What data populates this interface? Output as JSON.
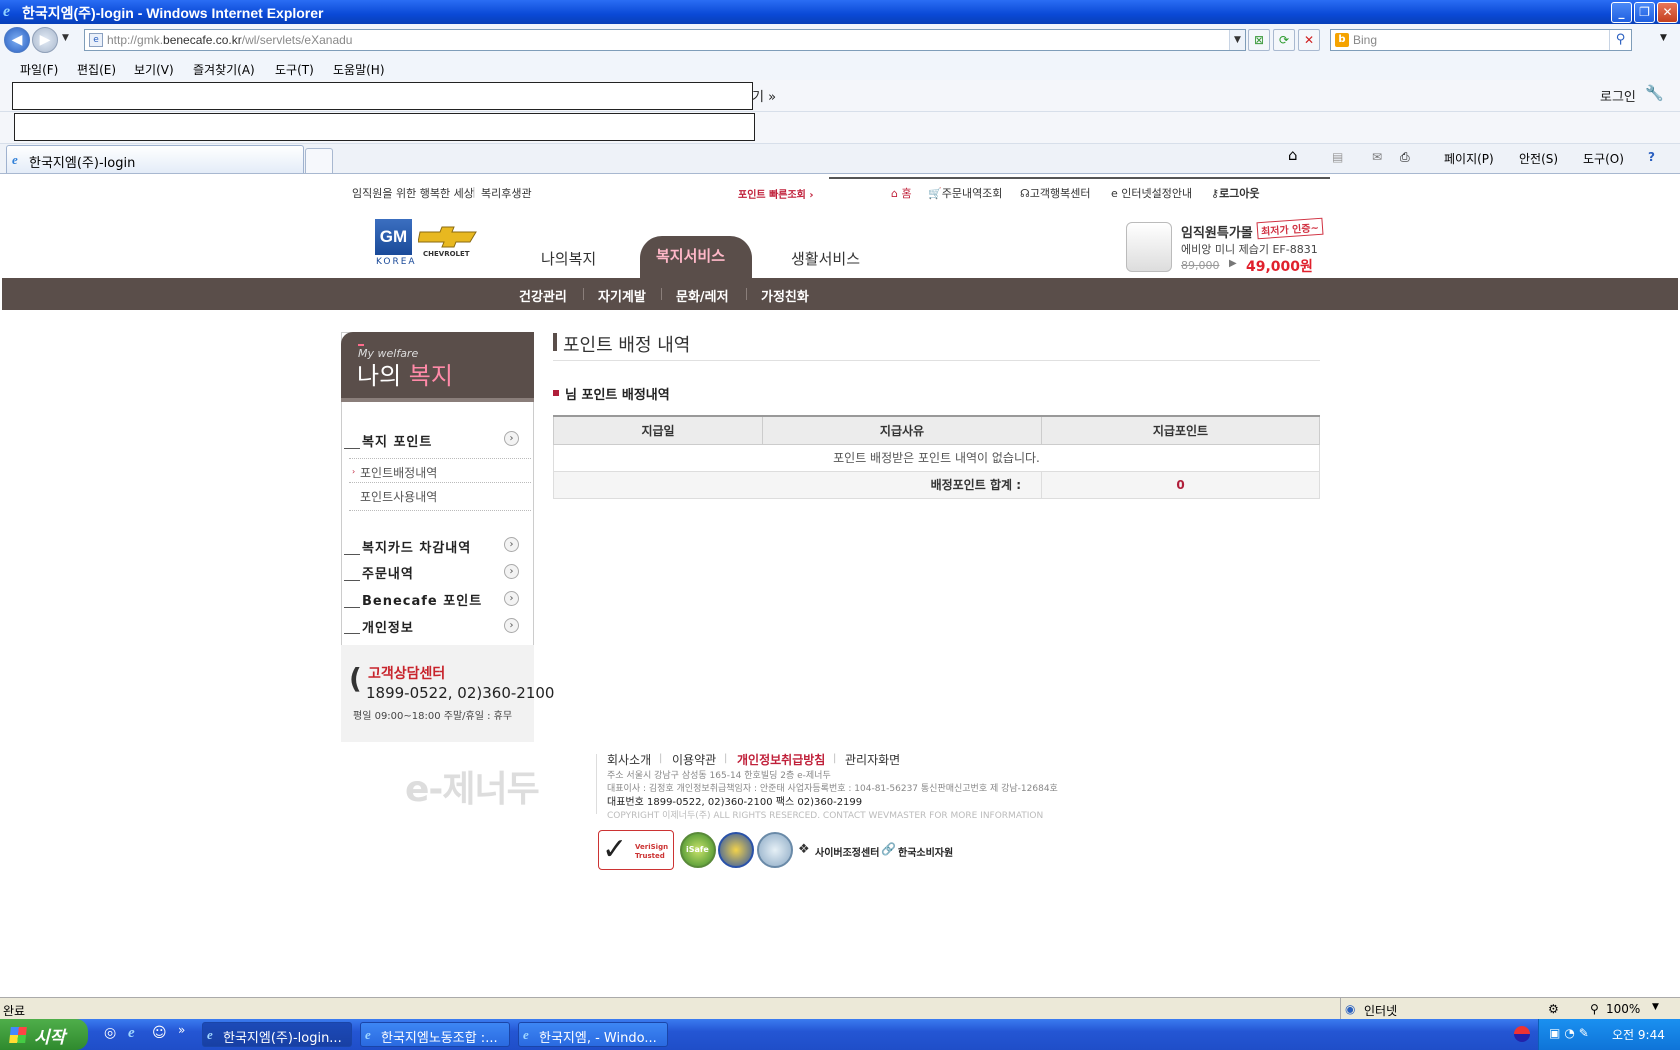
{
  "window": {
    "title": "한국지엠(주)-login - Windows Internet Explorer"
  },
  "address": {
    "url_prefix": "http://gmk.",
    "url_domain": "benecafe.co.kr",
    "url_path": "/wl/servlets/eXanadu"
  },
  "search": {
    "placeholder": "Bing"
  },
  "menu": [
    "파일(F)",
    "편집(E)",
    "보기(V)",
    "즐겨찾기(A)",
    "도구(T)",
    "도움말(H)"
  ],
  "toolbar": {
    "more": "기 »",
    "login": "로그인"
  },
  "tab": {
    "label": "한국지엠(주)-login"
  },
  "commands": {
    "page": "페이지(P)",
    "safety": "안전(S)",
    "tools": "도구(O)"
  },
  "site": {
    "top_left": [
      "임직원을 위한 행복한 세상",
      "복리후생관"
    ],
    "quick_point": "포인트 빠른조회 ›",
    "top_right": [
      "홈",
      "주문내역조회",
      "고객행복센터",
      "인터넷설정안내",
      "로그아웃"
    ],
    "logo": {
      "gm": "GM",
      "korea": "KOREA",
      "chevrolet": "CHEVROLET"
    },
    "main_tabs": [
      "나의복지",
      "복지서비스",
      "생활서비스"
    ],
    "sub_nav": [
      "건강관리",
      "자기계발",
      "문화/레저",
      "가정친화"
    ],
    "ad": {
      "title": "임직원특가몰",
      "badge": "최저가 인증~",
      "model": "에비앙 미니 제습기 EF-8831",
      "old_price": "89,000",
      "new_price": "49,000원"
    }
  },
  "sidebar": {
    "eyebrow": "My welfare",
    "title_a": "나의 ",
    "title_b": "복지",
    "point_menu": "복지 포인트",
    "sub_items": [
      "포인트배정내역",
      "포인트사용내역"
    ],
    "items": [
      "복지카드 차감내역",
      "주문내역",
      "Benecafe 포인트",
      "개인정보"
    ],
    "cs": {
      "title": "고객상담센터",
      "numbers": "1899-0522, 02)360-2100",
      "hours": "평일 09:00~18:00  주말/휴일 : 휴무"
    }
  },
  "content": {
    "title": "포인트 배정 내역",
    "subtitle": "님 포인트 배정내역",
    "columns": [
      "지급일",
      "지급사유",
      "지급포인트"
    ],
    "empty_message": "포인트 배정받은 포인트 내역이 없습니다.",
    "total_label": "배정포인트 합계 :",
    "total_value": "0"
  },
  "footer": {
    "logo": "e-제너두",
    "links": [
      "회사소개",
      "이용약관",
      "개인정보취급방침",
      "관리자화면"
    ],
    "address": "주소 서울시 강남구 삼성동 165-14 한호빌딩 2층 e-제너두",
    "ceo": "대표이사 : 김정호    개인정보취급책임자 : 안준태      사업자등록번호 : 104-81-56237   통신판매신고번호  제 강남-12684호",
    "phone": "대표번호 1899-0522, 02)360-2100   팩스 02)360-2199",
    "copyright": "COPYRIGHT 이제너두(주) ALL RIGHTS RESERCED.  CONTACT WEVMASTER FOR MORE INFORMATION",
    "certs": [
      "VeriSign Trusted",
      "iSafe",
      "사이버조정센터",
      "한국소비자원"
    ]
  },
  "status": {
    "left": "완료",
    "zone": "인터넷",
    "zoom": "100%"
  },
  "taskbar": {
    "start": "시작",
    "tasks": [
      "한국지엠(주)-login...",
      "한국지엠노동조합 :...",
      "한국지엠, - Windo..."
    ],
    "clock": "오전 9:44"
  }
}
